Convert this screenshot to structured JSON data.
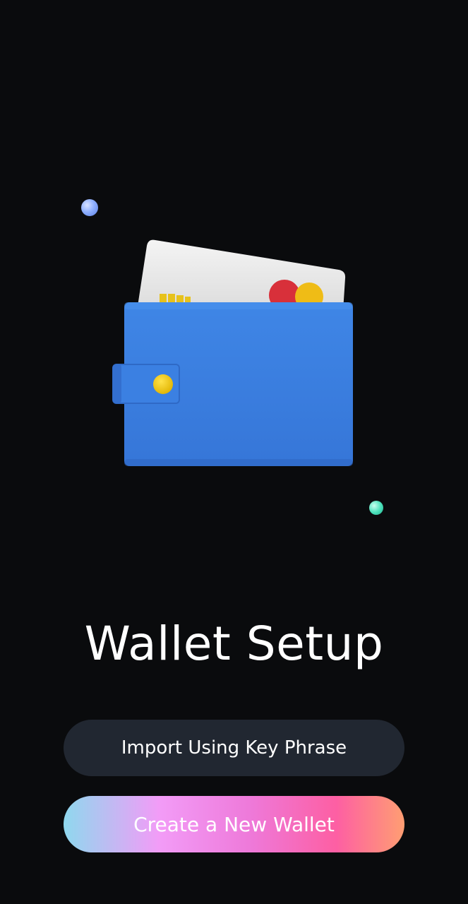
{
  "title": "Wallet Setup",
  "buttons": {
    "import_label": "Import Using Key Phrase",
    "create_label": "Create a New Wallet"
  },
  "illustration": {
    "icon": "wallet-icon"
  },
  "colors": {
    "background": "#0a0b0d",
    "wallet_blue": "#3a7fe0",
    "import_button_bg": "#212731",
    "gradient_start": "#8fd8ee",
    "gradient_mid": "#f29cf7",
    "gradient_pink": "#fd5fa3",
    "gradient_end": "#ff9e72"
  }
}
